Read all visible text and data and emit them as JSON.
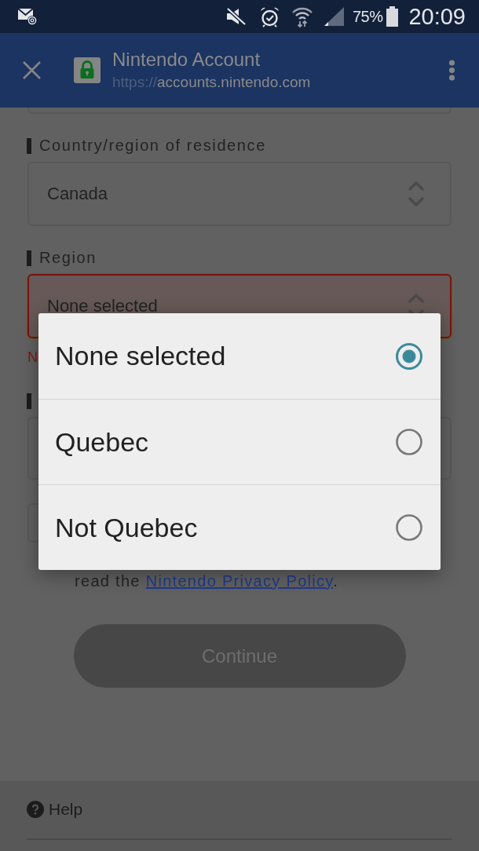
{
  "status_bar": {
    "battery": "75%",
    "time": "20:09"
  },
  "toolbar": {
    "title": "Nintendo Account",
    "url_scheme": "https://",
    "url_host": "accounts.nintendo.com"
  },
  "form": {
    "fields": [
      {
        "kind": "select",
        "label": "Country/region of residence",
        "value": "Canada",
        "error": false
      },
      {
        "kind": "select",
        "label": "Region",
        "value": "None selected",
        "error": true,
        "error_text": "N"
      },
      {
        "kind": "text"
      },
      {
        "kind": "box"
      }
    ],
    "consent_text": {
      "before": "read the ",
      "link": "Nintendo Privacy Policy",
      "after": "."
    },
    "continue_button": {
      "label": "Continue",
      "disabled": true
    }
  },
  "footer": {
    "help": "Help"
  },
  "picker": {
    "options": [
      {
        "label": "None selected",
        "selected": true
      },
      {
        "label": "Quebec",
        "selected": false
      },
      {
        "label": "Not Quebec",
        "selected": false
      }
    ]
  }
}
